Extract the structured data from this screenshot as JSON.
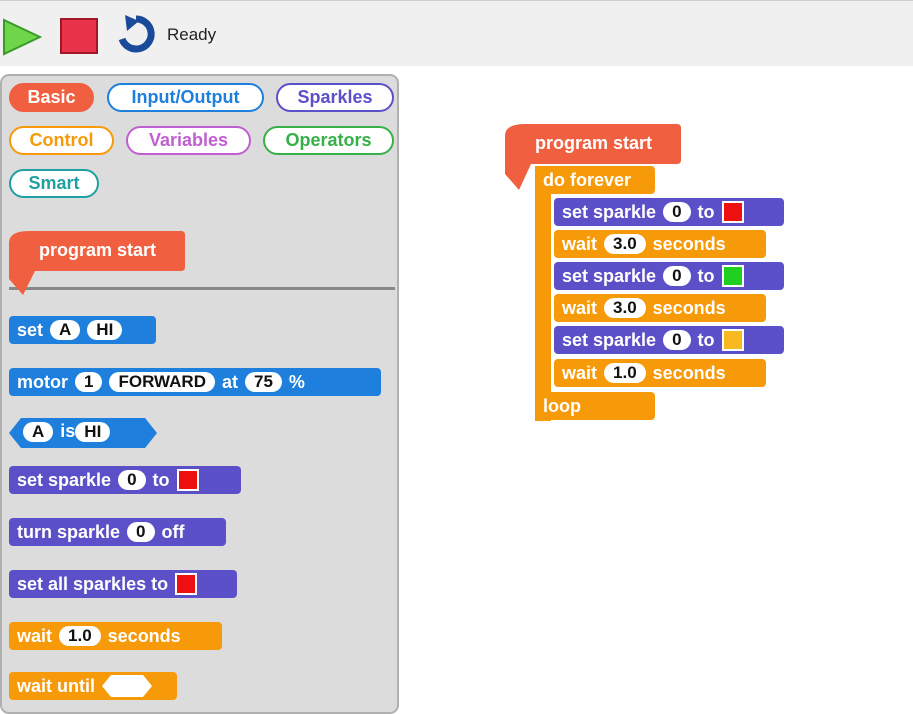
{
  "toolbar": {
    "status": "Ready",
    "icons": [
      "run-icon",
      "stop-icon",
      "reset-icon"
    ]
  },
  "palette": {
    "categories": [
      {
        "label": "Basic",
        "color": "#f06040",
        "active": true
      },
      {
        "label": "Input/Output",
        "color": "#1f7fdc",
        "active": false
      },
      {
        "label": "Sparkles",
        "color": "#5b50c8",
        "active": false
      },
      {
        "label": "Control",
        "color": "#f79a0a",
        "active": false
      },
      {
        "label": "Variables",
        "color": "#c060d0",
        "active": false
      },
      {
        "label": "Operators",
        "color": "#38b048",
        "active": false
      },
      {
        "label": "Smart",
        "color": "#20a0a0",
        "active": false
      }
    ],
    "blocks": {
      "program_start": "program start",
      "set": {
        "kw": "set",
        "pin": "A",
        "level": "HI"
      },
      "motor": {
        "kw": "motor",
        "num": "1",
        "dir": "FORWARD",
        "at": "at",
        "speed": "75",
        "pct": "%"
      },
      "is": {
        "pin": "A",
        "kw": "is",
        "level": "HI"
      },
      "set_sparkle": {
        "kw": "set sparkle",
        "num": "0",
        "to": "to",
        "color": "#ee1010"
      },
      "turn_sparkle": {
        "kw": "turn sparkle",
        "num": "0",
        "off": "off"
      },
      "set_all": {
        "kw": "set all sparkles to",
        "color": "#ee1010"
      },
      "wait": {
        "kw": "wait",
        "val": "1.0",
        "unit": "seconds"
      },
      "wait_until": {
        "kw": "wait until"
      }
    }
  },
  "workspace": {
    "program_start": "program start",
    "do_forever": "do forever",
    "loop": "loop",
    "steps": [
      {
        "type": "sparkle",
        "kw": "set sparkle",
        "num": "0",
        "to": "to",
        "color": "#ee1010"
      },
      {
        "type": "wait",
        "kw": "wait",
        "val": "3.0",
        "unit": "seconds"
      },
      {
        "type": "sparkle",
        "kw": "set sparkle",
        "num": "0",
        "to": "to",
        "color": "#20d020"
      },
      {
        "type": "wait",
        "kw": "wait",
        "val": "3.0",
        "unit": "seconds"
      },
      {
        "type": "sparkle",
        "kw": "set sparkle",
        "num": "0",
        "to": "to",
        "color": "#f8b820"
      },
      {
        "type": "wait",
        "kw": "wait",
        "val": "1.0",
        "unit": "seconds"
      }
    ]
  },
  "colors": {
    "hat": "#f06040",
    "control": "#f79a0a",
    "sparkles": "#5b50c8",
    "io": "#1f7fdc"
  }
}
